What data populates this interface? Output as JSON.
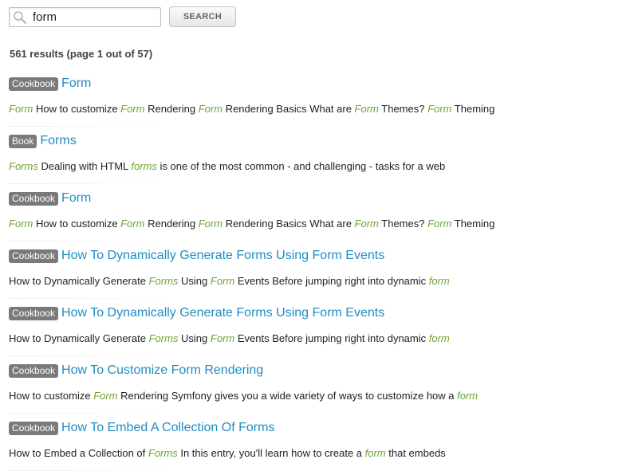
{
  "search": {
    "query": "form",
    "button_label": "SEARCH"
  },
  "summary": "561 results (page 1 out of 57)",
  "colors": {
    "link": "#1e8ec3",
    "highlight": "#6aa532",
    "badge": "#7a7a7a"
  },
  "results": [
    {
      "badge": "Cookbook",
      "title": "Form",
      "snippet": [
        {
          "text": "Form",
          "hl": true
        },
        {
          "text": " How to customize "
        },
        {
          "text": "Form",
          "hl": true
        },
        {
          "text": " Rendering "
        },
        {
          "text": "Form",
          "hl": true
        },
        {
          "text": " Rendering Basics What are "
        },
        {
          "text": "Form",
          "hl": true
        },
        {
          "text": " Themes? "
        },
        {
          "text": "Form",
          "hl": true
        },
        {
          "text": " Theming"
        }
      ]
    },
    {
      "badge": "Book",
      "title": "Forms",
      "snippet": [
        {
          "text": "Forms",
          "hl": true
        },
        {
          "text": " Dealing with HTML "
        },
        {
          "text": "forms",
          "hl": true
        },
        {
          "text": " is one of the most common - and challenging - tasks for a web"
        }
      ]
    },
    {
      "badge": "Cookbook",
      "title": "Form",
      "snippet": [
        {
          "text": "Form",
          "hl": true
        },
        {
          "text": " How to customize "
        },
        {
          "text": "Form",
          "hl": true
        },
        {
          "text": " Rendering "
        },
        {
          "text": "Form",
          "hl": true
        },
        {
          "text": " Rendering Basics What are "
        },
        {
          "text": "Form",
          "hl": true
        },
        {
          "text": " Themes? "
        },
        {
          "text": "Form",
          "hl": true
        },
        {
          "text": " Theming"
        }
      ]
    },
    {
      "badge": "Cookbook",
      "title": "How To Dynamically Generate Forms Using Form Events",
      "snippet": [
        {
          "text": "How to Dynamically Generate "
        },
        {
          "text": "Forms",
          "hl": true
        },
        {
          "text": " Using "
        },
        {
          "text": "Form",
          "hl": true
        },
        {
          "text": " Events Before jumping right into dynamic "
        },
        {
          "text": "form",
          "hl": true
        }
      ]
    },
    {
      "badge": "Cookbook",
      "title": "How To Dynamically Generate Forms Using Form Events",
      "snippet": [
        {
          "text": "How to Dynamically Generate "
        },
        {
          "text": "Forms",
          "hl": true
        },
        {
          "text": " Using "
        },
        {
          "text": "Form",
          "hl": true
        },
        {
          "text": " Events Before jumping right into dynamic "
        },
        {
          "text": "form",
          "hl": true
        }
      ]
    },
    {
      "badge": "Cookbook",
      "title": "How To Customize Form Rendering",
      "snippet": [
        {
          "text": "How to customize "
        },
        {
          "text": "Form",
          "hl": true
        },
        {
          "text": " Rendering Symfony gives you a wide variety of ways to customize how a "
        },
        {
          "text": "form",
          "hl": true
        }
      ]
    },
    {
      "badge": "Cookbook",
      "title": "How To Embed A Collection Of Forms",
      "snippet": [
        {
          "text": "How to Embed a Collection of "
        },
        {
          "text": "Forms",
          "hl": true
        },
        {
          "text": " In this entry, you'll learn how to create a "
        },
        {
          "text": "form",
          "hl": true
        },
        {
          "text": " that embeds"
        }
      ]
    }
  ]
}
